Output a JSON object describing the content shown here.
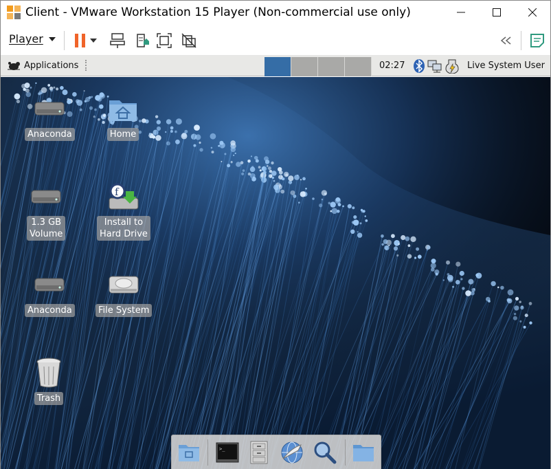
{
  "window": {
    "title": "Client - VMware Workstation 15 Player (Non-commercial use only)",
    "icons": {
      "app": "vmware-logo-icon",
      "minimize": "minimize-icon",
      "maximize": "maximize-icon",
      "close": "close-icon"
    }
  },
  "toolbar": {
    "player_label": "Player",
    "icons": [
      "pause-icon",
      "send-ctrl-alt-del-icon",
      "removable-devices-icon",
      "fullscreen-icon",
      "unity-icon",
      "collapse-icon",
      "notes-icon"
    ]
  },
  "panel": {
    "applications_label": "Applications",
    "workspaces": [
      {
        "active": true
      },
      {
        "active": false
      },
      {
        "active": false
      },
      {
        "active": false
      }
    ],
    "clock": "02:27",
    "tray_icons": [
      "bluetooth-icon",
      "network-icon",
      "power-icon"
    ],
    "user": "Live System User"
  },
  "desktop": {
    "icons": [
      {
        "label": "Anaconda",
        "icon": "drive-icon"
      },
      {
        "label": "Home",
        "icon": "home-folder-icon"
      },
      {
        "label": "1.3 GB\nVolume",
        "icon": "drive-icon"
      },
      {
        "label": "Install to\nHard Drive",
        "icon": "install-icon"
      },
      {
        "label": "Anaconda",
        "icon": "drive-icon"
      },
      {
        "label": "File System",
        "icon": "hard-disk-icon"
      },
      {
        "label": "Trash",
        "icon": "trash-icon"
      }
    ]
  },
  "dock": {
    "items": [
      "show-desktop-icon",
      "terminal-icon",
      "file-cabinet-icon",
      "web-browser-icon",
      "search-icon",
      "folder-icon"
    ]
  },
  "colors": {
    "accent": "#356da6",
    "pause": "#f0642a",
    "notes": "#2f9a7f"
  }
}
